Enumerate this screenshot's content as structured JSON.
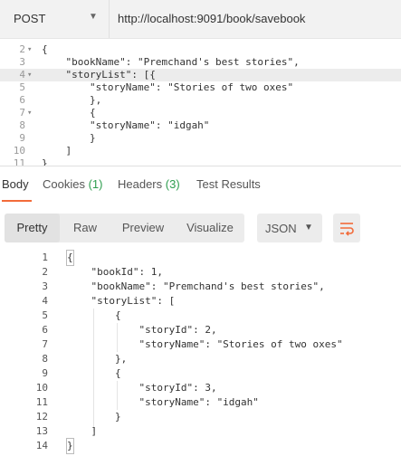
{
  "request": {
    "method": "POST",
    "url": "http://localhost:9091/book/savebook"
  },
  "request_body": {
    "lines": [
      {
        "num": "2",
        "fold": "▾",
        "text": "{"
      },
      {
        "num": "3",
        "fold": "",
        "text": "    \"bookName\": \"Premchand's best stories\","
      },
      {
        "num": "4",
        "fold": "▾",
        "text": "    \"storyList\": [{"
      },
      {
        "num": "5",
        "fold": "",
        "text": "        \"storyName\": \"Stories of two oxes\""
      },
      {
        "num": "6",
        "fold": "",
        "text": "        },"
      },
      {
        "num": "7",
        "fold": "▾",
        "text": "        {"
      },
      {
        "num": "8",
        "fold": "",
        "text": "        \"storyName\": \"idgah\""
      },
      {
        "num": "9",
        "fold": "",
        "text": "        }"
      },
      {
        "num": "10",
        "fold": "",
        "text": "    ]"
      },
      {
        "num": "11",
        "fold": "",
        "text": "}"
      }
    ]
  },
  "response_tabs": {
    "body": "Body",
    "cookies": "Cookies",
    "cookies_count": "(1)",
    "headers": "Headers",
    "headers_count": "(3)",
    "test_results": "Test Results"
  },
  "toolbar": {
    "pretty": "Pretty",
    "raw": "Raw",
    "preview": "Preview",
    "visualize": "Visualize",
    "format": "JSON"
  },
  "response_body": {
    "lines": [
      {
        "num": "1",
        "text": "{"
      },
      {
        "num": "2",
        "text": "    \"bookId\": 1,"
      },
      {
        "num": "3",
        "text": "    \"bookName\": \"Premchand's best stories\","
      },
      {
        "num": "4",
        "text": "    \"storyList\": ["
      },
      {
        "num": "5",
        "text": "        {"
      },
      {
        "num": "6",
        "text": "            \"storyId\": 2,"
      },
      {
        "num": "7",
        "text": "            \"storyName\": \"Stories of two oxes\""
      },
      {
        "num": "8",
        "text": "        },"
      },
      {
        "num": "9",
        "text": "        {"
      },
      {
        "num": "10",
        "text": "            \"storyId\": 3,"
      },
      {
        "num": "11",
        "text": "            \"storyName\": \"idgah\""
      },
      {
        "num": "12",
        "text": "        }"
      },
      {
        "num": "13",
        "text": "    ]"
      },
      {
        "num": "14",
        "text": "}"
      }
    ]
  },
  "colors": {
    "accent": "#f26b3a",
    "count_green": "#2e9e4f"
  }
}
